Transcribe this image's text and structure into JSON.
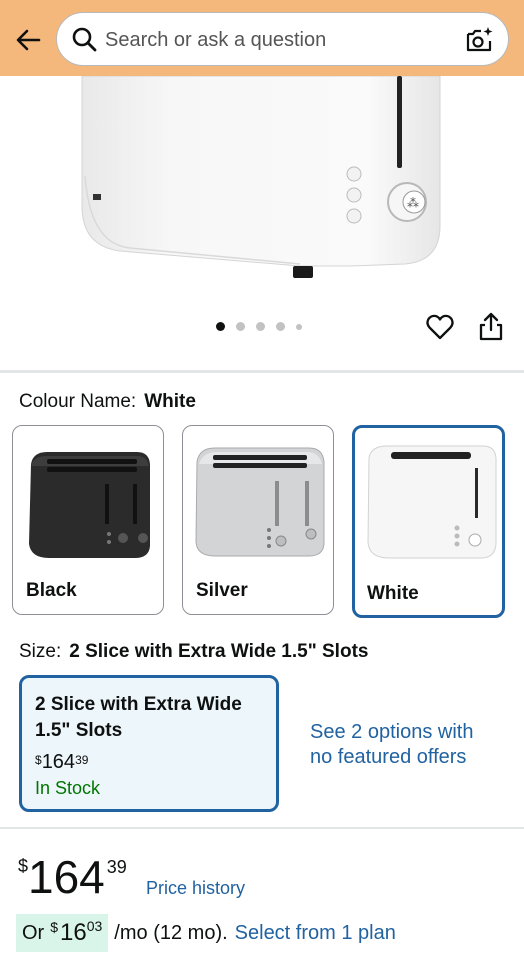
{
  "header": {
    "search_placeholder": "Search or ask a question",
    "background_color": "#f4b77c"
  },
  "carousel": {
    "total_images": 5,
    "active_index": 0
  },
  "colour": {
    "label": "Colour Name:",
    "selected": "White",
    "options": [
      {
        "label": "Black"
      },
      {
        "label": "Silver"
      },
      {
        "label": "White"
      }
    ]
  },
  "size": {
    "label": "Size:",
    "selected": "2 Slice with Extra Wide 1.5\" Slots",
    "card": {
      "title": "2 Slice with Extra Wide 1.5\" Slots",
      "currency": "$",
      "price_whole": "164",
      "price_fraction": "39",
      "stock": "In Stock"
    },
    "other_options_link": "See 2 options with no featured offers"
  },
  "price": {
    "currency": "$",
    "whole": "164",
    "fraction": "39",
    "history_link": "Price history"
  },
  "monthly": {
    "prefix": "Or",
    "currency": "$",
    "whole": "16",
    "fraction": "03",
    "per": "/mo (12 mo).",
    "plan_link": "Select from 1 plan"
  },
  "colors": {
    "link": "#2162a1",
    "selected_border": "#2162a1",
    "in_stock": "#007600",
    "monthly_highlight": "#d9f5e9"
  },
  "icons": {
    "back": "back-arrow-icon",
    "search": "search-icon",
    "camera": "camera-search-icon",
    "wishlist": "heart-icon",
    "share": "share-icon"
  }
}
